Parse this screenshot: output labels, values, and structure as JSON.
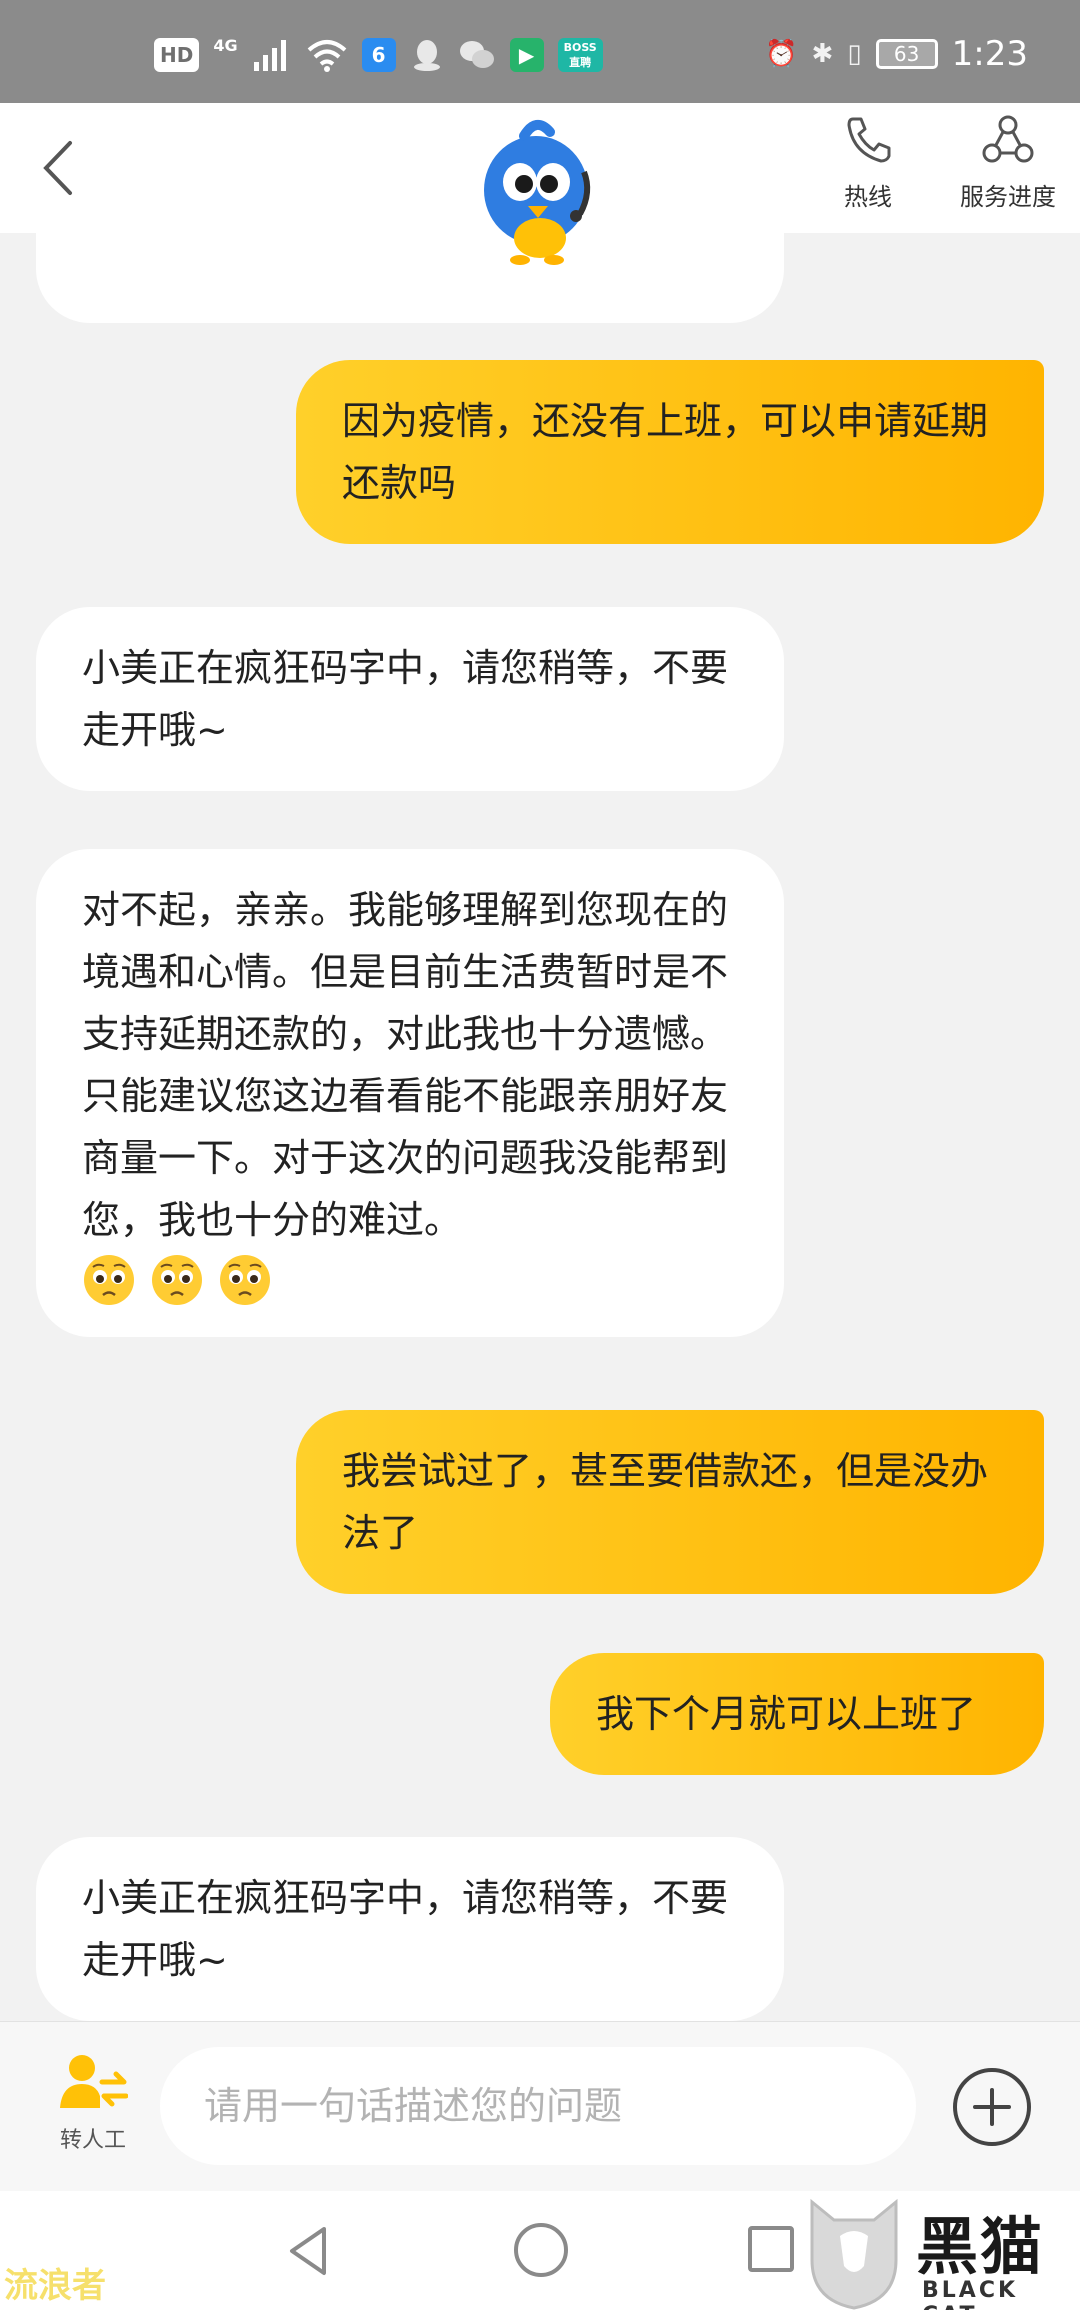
{
  "status_bar": {
    "hd": "HD",
    "network": "4G",
    "boss_line1": "BOSS",
    "boss_line2": "直聘",
    "battery": "63",
    "time": "1:23"
  },
  "header": {
    "hotline_label": "热线",
    "progress_label": "服务进度"
  },
  "messages": [
    {
      "side": "right",
      "text": "因为疫情，还没有上班，可以申请延期还款吗"
    },
    {
      "side": "left",
      "text": "小美正在疯狂码字中，请您稍等，不要走开哦~"
    },
    {
      "side": "left",
      "text": "对不起，亲亲。我能够理解到您现在的境遇和心情。但是目前生活费暂时是不支持延期还款的，对此我也十分遗憾。只能建议您这边看看能不能跟亲朋好友商量一下。对于这次的问题我没能帮到您，我也十分的难过。",
      "emoji": [
        "pleading-face-icon",
        "pleading-face-icon",
        "pleading-face-icon"
      ]
    },
    {
      "side": "right",
      "text": "我尝试过了，甚至要借款还，但是没办法了"
    },
    {
      "side": "right",
      "text": "我下个月就可以上班了"
    },
    {
      "side": "left",
      "text": "小美正在疯狂码字中，请您稍等，不要走开哦~"
    }
  ],
  "input_bar": {
    "human_label": "转人工",
    "placeholder": "请用一句话描述您的问题",
    "value": ""
  },
  "watermarks": {
    "left": "流浪者",
    "right_cn": "黑猫",
    "right_en": "BLACK CAT"
  },
  "colors": {
    "accent": "#ffc107",
    "bubble_right_start": "#ffd02a",
    "bubble_right_end": "#ffb400",
    "background": "#f2f2f2",
    "status_bar": "#8b8b8b"
  }
}
